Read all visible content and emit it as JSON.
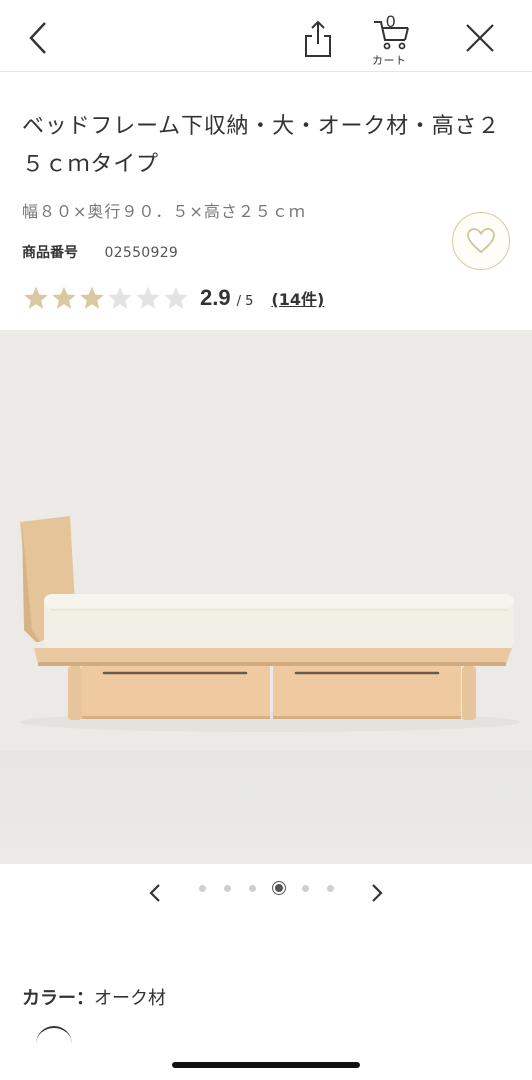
{
  "header": {
    "back_icon": "chevron-left-icon",
    "share_icon": "share-icon",
    "cart": {
      "count": "0",
      "label": "カート",
      "icon": "cart-icon"
    },
    "close_icon": "close-icon"
  },
  "product": {
    "title": "ベッドフレーム下収納・大・オーク材・高さ２５ｃｍタイプ",
    "size": "幅８０×奥行９０．５×高さ２５ｃｍ",
    "code_label": "商品番号",
    "code": "02550929",
    "rating": {
      "score": "2.9",
      "max": "/ 5",
      "reviews": "(14件)",
      "stars_filled": 3,
      "stars_total": 6
    },
    "favorite_icon": "heart-icon"
  },
  "carousel": {
    "prev_icon": "chevron-left-icon",
    "next_icon": "chevron-right-icon",
    "dot_count": 6,
    "active_index": 3
  },
  "color": {
    "label": "カラー：",
    "value": "オーク材"
  },
  "colors": {
    "star_filled": "#d9c9a0",
    "star_empty": "#e3e3e3",
    "wood": "#e9c9a2",
    "mattress": "#f1eee4"
  }
}
